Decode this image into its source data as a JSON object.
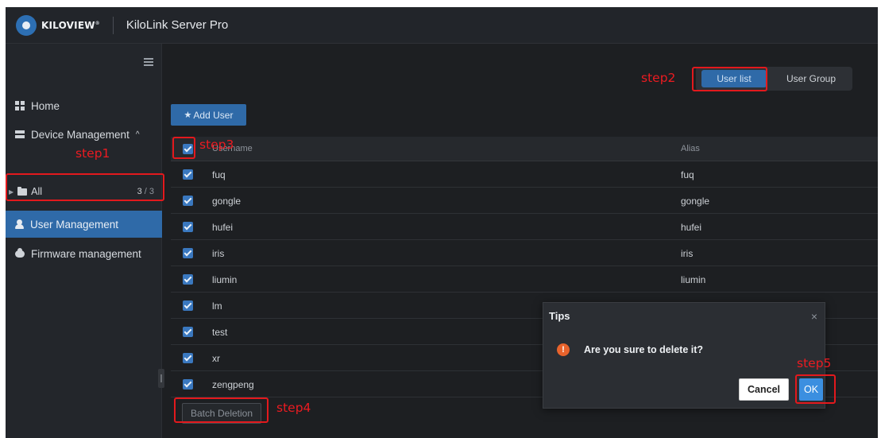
{
  "brand": {
    "logo_text": "KILOVIEW",
    "logo_mark": "®",
    "app_title": "KiloLink Server Pro"
  },
  "sidebar": {
    "collapse_icon": "collapse-menu-icon",
    "items": [
      {
        "label": "Home",
        "icon": "home-grid-icon"
      },
      {
        "label": "Device Management",
        "icon": "device-icon",
        "chevron": "^"
      },
      {
        "label": "All",
        "icon": "folder-icon",
        "count_current": "3",
        "count_sep": "/",
        "count_total": "3"
      },
      {
        "label": "User Management",
        "icon": "user-icon",
        "active": true
      },
      {
        "label": "Firmware management",
        "icon": "cloud-icon"
      }
    ]
  },
  "tabs": [
    {
      "label": "User list",
      "active": true
    },
    {
      "label": "User Group"
    }
  ],
  "toolbar": {
    "add_user": "Add User",
    "add_icon": "user-add-icon"
  },
  "table": {
    "columns": {
      "name": "Username",
      "alias": "Alias"
    },
    "rows": [
      {
        "name": "fuq",
        "alias": "fuq"
      },
      {
        "name": "gongle",
        "alias": "gongle"
      },
      {
        "name": "hufei",
        "alias": "hufei"
      },
      {
        "name": "iris",
        "alias": "iris"
      },
      {
        "name": "liumin",
        "alias": "liumin"
      },
      {
        "name": "lm",
        "alias": "lm"
      },
      {
        "name": "test",
        "alias": ""
      },
      {
        "name": "xr",
        "alias": ""
      },
      {
        "name": "zengpeng",
        "alias": ""
      }
    ]
  },
  "batch_delete": "Batch Deletion",
  "dialog": {
    "title": "Tips",
    "close": "×",
    "warn_glyph": "!",
    "message": "Are you sure to delete it?",
    "cancel": "Cancel",
    "ok": "OK"
  },
  "annotations": {
    "color": "#e3191d",
    "step1": "step1",
    "step2": "step2",
    "step3": "step3",
    "step4": "step4",
    "step5": "step5"
  },
  "colors": {
    "accent": "#2f6aa8",
    "background": "#1d1f22",
    "warning": "#e8632c",
    "ok_button": "#3b8fe0"
  }
}
